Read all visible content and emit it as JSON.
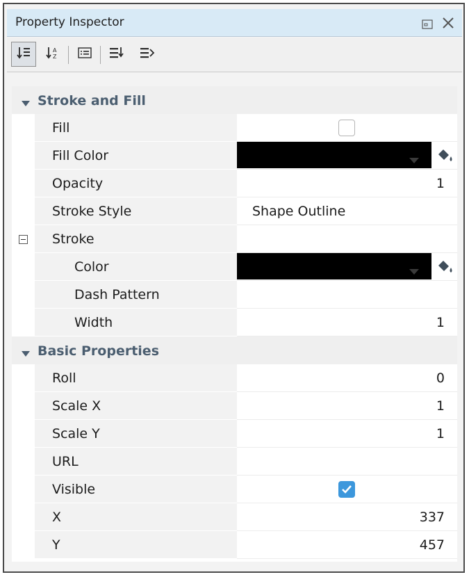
{
  "panel": {
    "title": "Property Inspector",
    "controls": [
      "restore-icon",
      "close-icon"
    ]
  },
  "toolbar": {
    "buttons": [
      {
        "icon": "sort-categorized-icon",
        "active": true
      },
      {
        "icon": "sort-alphabetical-icon",
        "active": false
      },
      {
        "icon": "description-icon",
        "active": false
      },
      {
        "icon": "expand-all-icon",
        "active": false
      },
      {
        "icon": "collapse-all-icon",
        "active": false
      }
    ]
  },
  "categories": [
    {
      "label": "Stroke and Fill"
    },
    {
      "label": "Basic Properties"
    }
  ],
  "properties": {
    "fill": {
      "name": "Fill",
      "checked": false
    },
    "fill_color": {
      "name": "Fill Color",
      "color": "#000000"
    },
    "opacity": {
      "name": "Opacity",
      "value": "1"
    },
    "stroke_style": {
      "name": "Stroke Style",
      "value": "Shape Outline"
    },
    "stroke": {
      "name": "Stroke"
    },
    "stroke_color": {
      "name": "Color",
      "color": "#000000"
    },
    "dash_pattern": {
      "name": "Dash Pattern",
      "value": ""
    },
    "width": {
      "name": "Width",
      "value": "1"
    },
    "roll": {
      "name": "Roll",
      "value": "0"
    },
    "scale_x": {
      "name": "Scale X",
      "value": "1"
    },
    "scale_y": {
      "name": "Scale Y",
      "value": "1"
    },
    "url": {
      "name": "URL",
      "value": ""
    },
    "visible": {
      "name": "Visible",
      "checked": true
    },
    "x": {
      "name": "X",
      "value": "337"
    },
    "y": {
      "name": "Y",
      "value": "457"
    }
  },
  "colors": {
    "title_bg": "#d8eaf6",
    "category_text": "#4b5e70",
    "checkbox_checked": "#3c97dc"
  }
}
